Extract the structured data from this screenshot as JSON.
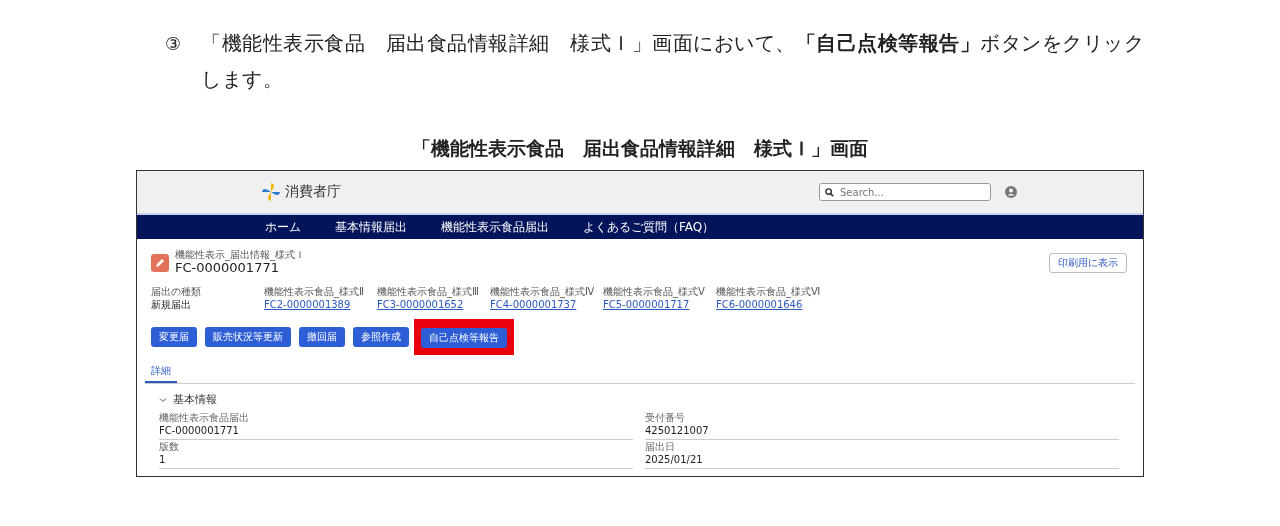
{
  "instruction": {
    "number": "③",
    "text": "「機能性表示食品　届出食品情報詳細　様式Ｉ」画面において、**「自己点検等報告」**ボタンをクリックします。"
  },
  "caption": "「機能性表示食品　届出食品情報詳細　様式Ｉ」画面",
  "screen": {
    "logo_text": "消費者庁",
    "search": {
      "placeholder": "Search..."
    },
    "nav": [
      "ホーム",
      "基本情報届出",
      "機能性表示食品届出",
      "よくあるご質問（FAQ）"
    ],
    "record": {
      "type_label": "機能性表示_届出情報_様式Ｉ",
      "id": "FC-0000001771"
    },
    "print_button": "印刷用に表示",
    "summary_fields": [
      {
        "label": "届出の種類",
        "value": "新規届出",
        "kind": "text"
      },
      {
        "label": "機能性表示食品_様式Ⅱ",
        "value": "FC2-0000001389",
        "kind": "link"
      },
      {
        "label": "機能性表示食品_様式Ⅲ",
        "value": "FC3-0000001652",
        "kind": "link"
      },
      {
        "label": "機能性表示食品_様式Ⅳ",
        "value": "FC4-0000001737",
        "kind": "link"
      },
      {
        "label": "機能性表示食品_様式Ⅴ",
        "value": "FC5-0000001717",
        "kind": "link"
      },
      {
        "label": "機能性表示食品_様式Ⅵ",
        "value": "FC6-0000001646",
        "kind": "link"
      }
    ],
    "action_buttons": [
      {
        "label": "変更届",
        "highlighted": false
      },
      {
        "label": "販売状況等更新",
        "highlighted": false
      },
      {
        "label": "撤回届",
        "highlighted": false
      },
      {
        "label": "参照作成",
        "highlighted": false
      },
      {
        "label": "自己点検等報告",
        "highlighted": true
      }
    ],
    "tabs": [
      {
        "label": "詳細",
        "selected": true
      }
    ],
    "section": {
      "title": "基本情報",
      "expanded": true,
      "fields_left": [
        {
          "label": "機能性表示食品届出",
          "value": "FC-0000001771"
        },
        {
          "label": "版数",
          "value": "1"
        }
      ],
      "fields_right": [
        {
          "label": "受付番号",
          "value": "4250121007"
        },
        {
          "label": "届出日",
          "value": "2025/01/21"
        }
      ]
    }
  }
}
